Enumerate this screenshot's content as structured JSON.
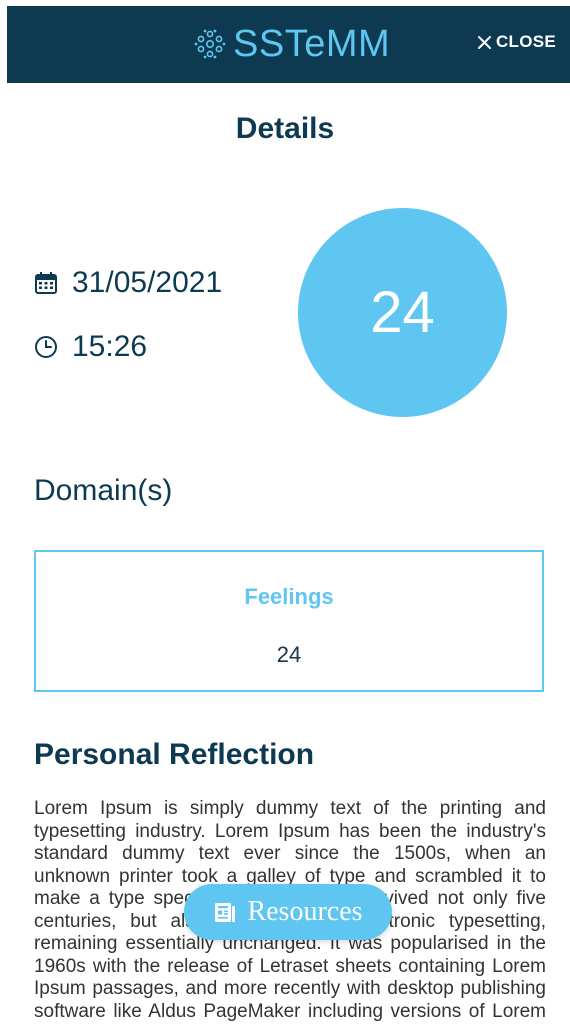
{
  "header": {
    "brand": "SSTeMM",
    "close_label": "CLOSE"
  },
  "details": {
    "title": "Details",
    "date": "31/05/2021",
    "time": "15:26",
    "score": "24"
  },
  "domains": {
    "title": "Domain(s)",
    "items": [
      {
        "name": "Feelings",
        "score": "24"
      }
    ]
  },
  "reflection": {
    "title": "Personal Reflection",
    "text": "Lorem Ipsum is simply dummy text of the printing and typesetting industry. Lorem Ipsum has been the industry's standard dummy text ever since the 1500s, when an unknown printer took a galley of type and scrambled it to make a type specimen book. It has survived not only five centuries, but also the leap into electronic typesetting, remaining essentially unchanged. It was popularised in the 1960s with the release of Letraset sheets containing Lorem Ipsum passages, and more recently with desktop publishing software like Aldus PageMaker including versions of Lorem Ipsum."
  },
  "fab": {
    "resources_label": "Resources"
  },
  "colors": {
    "header_bg": "#0d3a51",
    "accent": "#5ec6f1",
    "text_dark": "#0d3a51"
  },
  "icons": {
    "logo": "molecule-logo-icon",
    "close": "close-icon",
    "date": "calendar-icon",
    "time": "clock-icon",
    "resources": "document-icon"
  }
}
